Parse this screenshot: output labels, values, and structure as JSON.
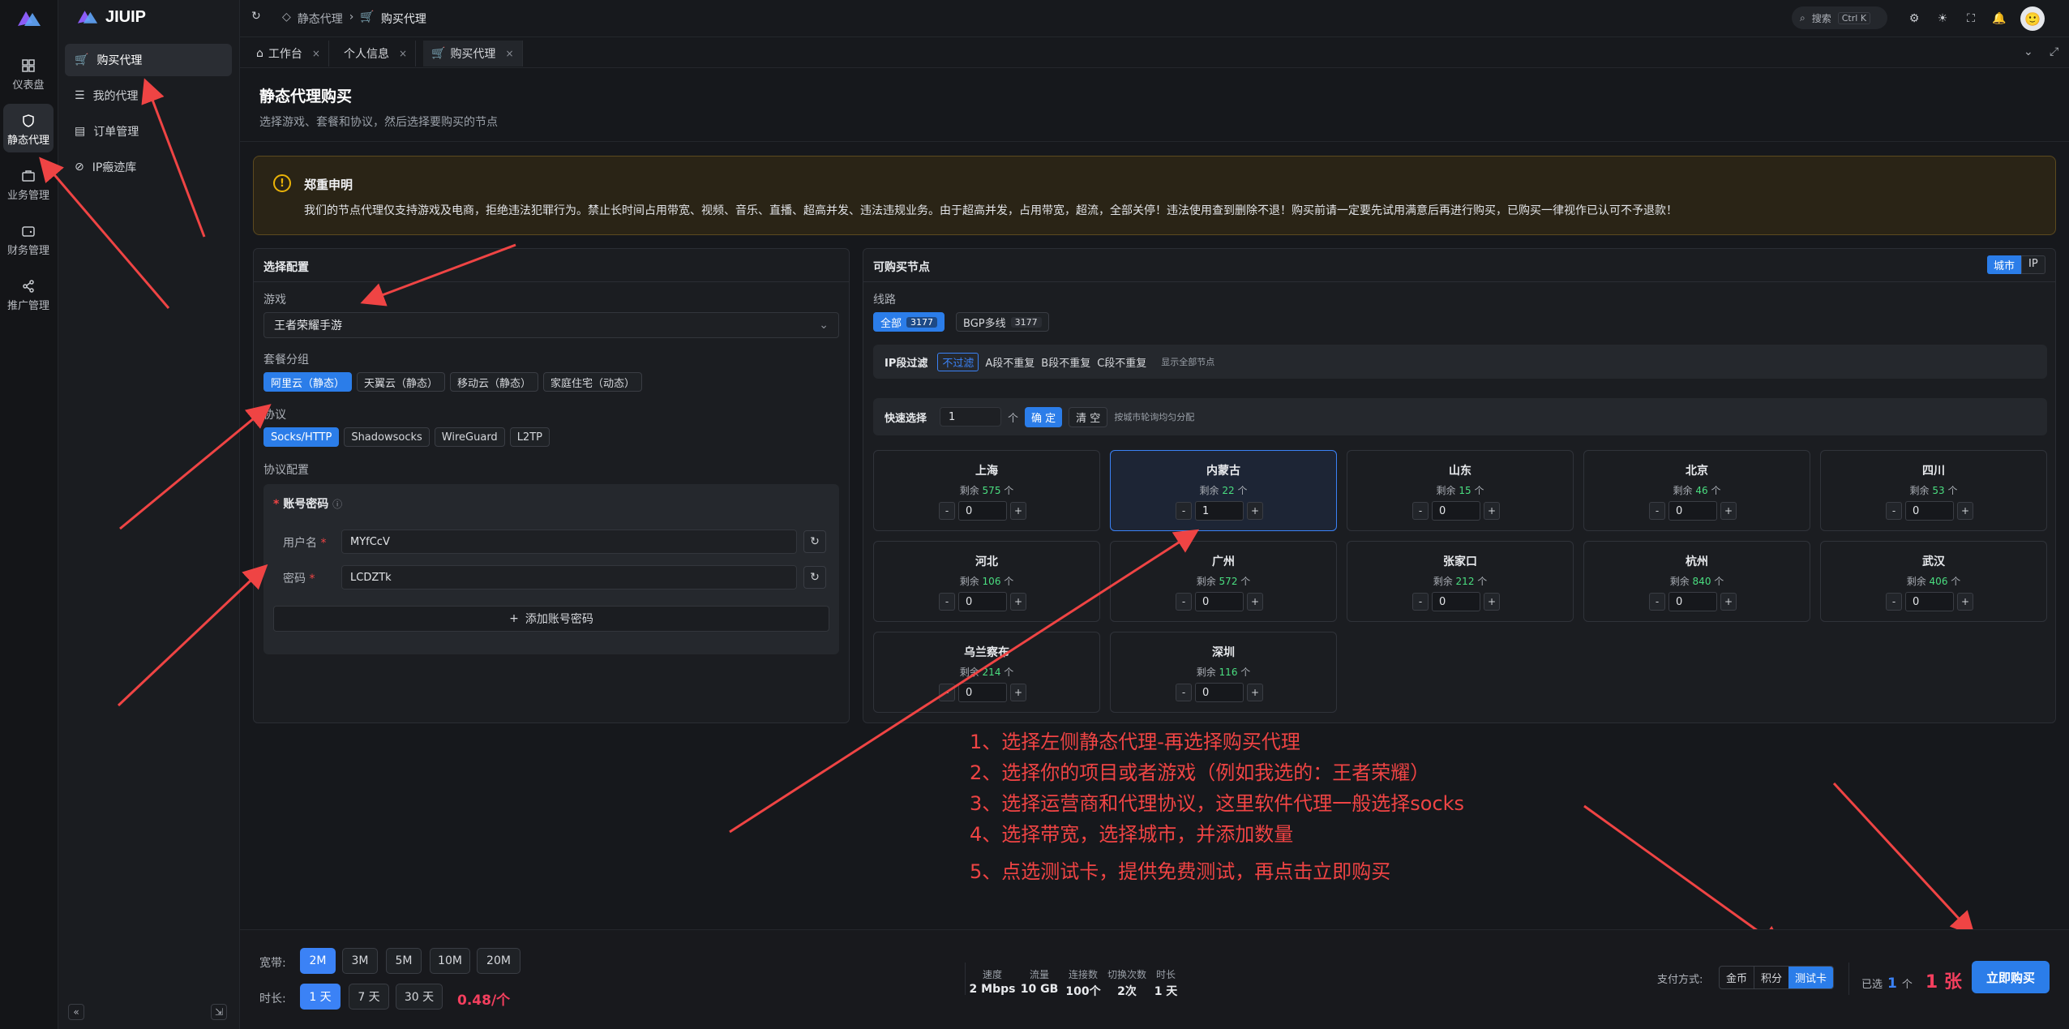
{
  "rail": {
    "items": [
      {
        "label": "仪表盘",
        "icon": "dashboard-icon"
      },
      {
        "label": "静态代理",
        "icon": "shield-icon"
      },
      {
        "label": "业务管理",
        "icon": "briefcase-icon"
      },
      {
        "label": "财务管理",
        "icon": "wallet-icon"
      },
      {
        "label": "推广管理",
        "icon": "share-icon"
      }
    ]
  },
  "app": {
    "name": "JIUIP"
  },
  "sidebar": {
    "items": [
      {
        "label": "购买代理",
        "icon": "cart-icon"
      },
      {
        "label": "我的代理",
        "icon": "list-icon"
      },
      {
        "label": "订单管理",
        "icon": "doc-icon"
      },
      {
        "label": "IP瘢迹库",
        "icon": "ban-icon"
      }
    ]
  },
  "header": {
    "breadcrumb": [
      "静态代理",
      "购买代理"
    ],
    "search": "搜索",
    "shortcut": "Ctrl K"
  },
  "tabs": [
    {
      "label": "工作台"
    },
    {
      "label": "个人信息"
    },
    {
      "label": "购买代理"
    }
  ],
  "page": {
    "title": "静态代理购买",
    "subtitle": "选择游戏、套餐和协议，然后选择要购买的节点"
  },
  "notice": {
    "title": "郑重申明",
    "text": "我们的节点代理仅支持游戏及电商，拒绝违法犯罪行为。禁止长时间占用带宽、视频、音乐、直播、超高并发、违法违规业务。由于超高并发，占用带宽，超流，全部关停！违法使用查到删除不退！购买前请一定要先试用满意后再进行购买，已购买一律视作已认可不予退款！"
  },
  "config": {
    "title": "选择配置",
    "game_label": "游戏",
    "game_value": "王者荣耀手游",
    "package_label": "套餐分组",
    "packages": [
      "阿里云（静态）",
      "天翼云（静态）",
      "移动云（静态）",
      "家庭住宅（动态）"
    ],
    "protocol_label": "协议",
    "protocols": [
      "Socks/HTTP",
      "Shadowsocks",
      "WireGuard",
      "L2TP"
    ],
    "protocol_config_label": "协议配置",
    "account_title": "账号密码",
    "username_label": "用户名",
    "username_value": "MYfCcV",
    "password_label": "密码",
    "password_value": "LCDZTk",
    "add_account": "添加账号密码"
  },
  "nodes": {
    "title": "可购买节点",
    "toggle": [
      "城市",
      "IP"
    ],
    "line_label": "线路",
    "lines": [
      {
        "label": "全部",
        "count": "3177"
      },
      {
        "label": "BGP多线",
        "count": "3177"
      }
    ],
    "ipfilter_label": "IP段过滤",
    "ipfilters": [
      "不过滤",
      "A段不重复",
      "B段不重复",
      "C段不重复"
    ],
    "show_all": "显示全部节点",
    "quick_label": "快速选择",
    "quick_value": "1",
    "quick_unit": "个",
    "confirm": "确 定",
    "clear": "清 空",
    "quick_hint": "按城市轮询均匀分配",
    "remain_prefix": "剩余",
    "remain_suffix": "个",
    "cities": [
      {
        "name": "上海",
        "remain": "575",
        "qty": "0"
      },
      {
        "name": "内蒙古",
        "remain": "22",
        "qty": "1"
      },
      {
        "name": "山东",
        "remain": "15",
        "qty": "0"
      },
      {
        "name": "北京",
        "remain": "46",
        "qty": "0"
      },
      {
        "name": "四川",
        "remain": "53",
        "qty": "0"
      },
      {
        "name": "河北",
        "remain": "106",
        "qty": "0"
      },
      {
        "name": "广州",
        "remain": "572",
        "qty": "0"
      },
      {
        "name": "张家口",
        "remain": "212",
        "qty": "0"
      },
      {
        "name": "杭州",
        "remain": "840",
        "qty": "0"
      },
      {
        "name": "武汉",
        "remain": "406",
        "qty": "0"
      },
      {
        "name": "乌兰察布",
        "remain": "214",
        "qty": "0"
      },
      {
        "name": "深圳",
        "remain": "116",
        "qty": "0"
      }
    ]
  },
  "annotations": [
    "1、选择左侧静态代理-再选择购买代理",
    "2、选择你的项目或者游戏（例如我选的：王者荣耀）",
    "3、选择运营商和代理协议，这里软件代理一般选择socks",
    "4、选择带宽，选择城市，并添加数量",
    "5、点选测试卡，提供免费测试，再点击立即购买"
  ],
  "footer": {
    "bandwidth_label": "宽带:",
    "bandwidths": [
      "2M",
      "3M",
      "5M",
      "10M",
      "20M"
    ],
    "duration_label": "时长:",
    "durations": [
      "1 天",
      "7 天",
      "30 天"
    ],
    "price": "0.48/个",
    "stats": [
      {
        "k": "速度",
        "v": "2 Mbps"
      },
      {
        "k": "流量",
        "v": "10 GB"
      },
      {
        "k": "连接数",
        "v": "100个"
      },
      {
        "k": "切换次数",
        "v": "2次"
      },
      {
        "k": "时长",
        "v": "1 天"
      }
    ],
    "pay_label": "支付方式:",
    "pay_options": [
      "金币",
      "积分",
      "测试卡"
    ],
    "selected_prefix": "已选",
    "selected_count": "1",
    "selected_unit": "个",
    "total": "1 张",
    "buy": "立即购买"
  },
  "colors": {
    "accent": "#3b82f6",
    "warn": "#eab308",
    "annotation": "#ef4444",
    "remain": "#4ade80",
    "price": "#f43f5e"
  }
}
